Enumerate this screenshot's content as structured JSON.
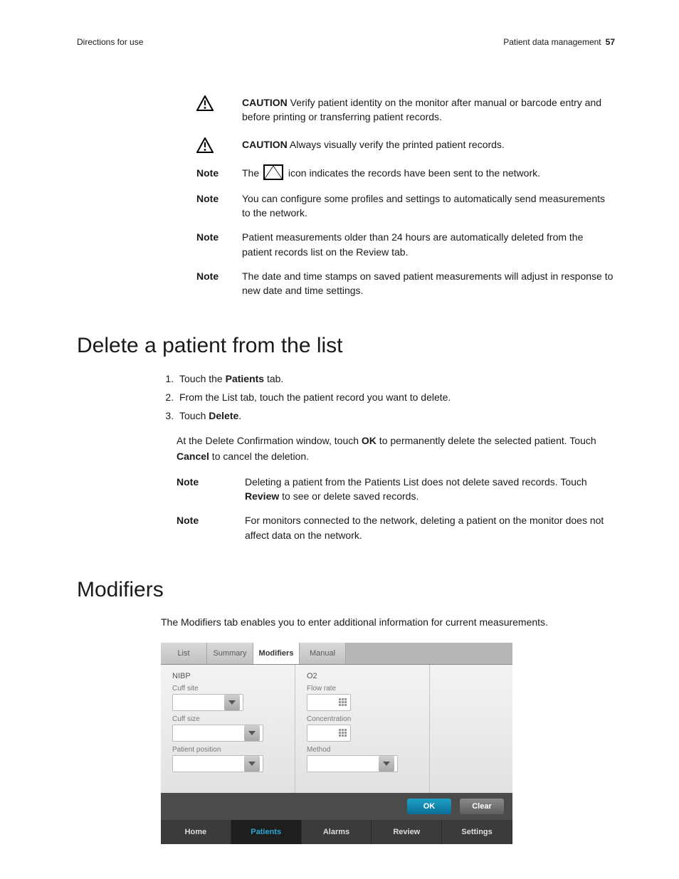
{
  "header": {
    "left": "Directions for use",
    "right_text": "Patient data management",
    "page_no": "57"
  },
  "cautions": [
    {
      "label": "CAUTION",
      "text": "Verify patient identity on the monitor after manual or barcode entry and before printing or transferring patient records."
    },
    {
      "label": "CAUTION",
      "text": "Always visually verify the printed patient records."
    }
  ],
  "top_notes": [
    {
      "label": "Note",
      "pre": "The ",
      "post": " icon indicates the records have been sent to the network.",
      "with_icon": true
    },
    {
      "label": "Note",
      "text": "You can configure some profiles and settings to automatically send measurements to the network."
    },
    {
      "label": "Note",
      "text": "Patient measurements older than 24 hours are automatically deleted from the patient records list on the Review tab."
    },
    {
      "label": "Note",
      "text": "The date and time stamps on saved patient measurements will adjust in response to new date and time settings."
    }
  ],
  "delete_section": {
    "title": "Delete a patient from the list",
    "steps": {
      "s1_pre": "Touch the ",
      "s1_bold": "Patients",
      "s1_post": " tab.",
      "s2": "From the List tab, touch the patient record you want to delete.",
      "s3_pre": "Touch ",
      "s3_bold": "Delete",
      "s3_post": "."
    },
    "after": {
      "p1": "At the Delete Confirmation window, touch ",
      "ok": "OK",
      "p2": " to permanently delete the selected patient. Touch ",
      "cancel": "Cancel",
      "p3": " to cancel the deletion."
    },
    "notes": [
      {
        "label": "Note",
        "pre": "Deleting a patient from the Patients List does not delete saved records. Touch ",
        "bold": "Review",
        "post": " to see or delete saved records."
      },
      {
        "label": "Note",
        "text": "For monitors connected to the network, deleting a patient on the monitor does not affect data on the network."
      }
    ]
  },
  "modifiers_section": {
    "title": "Modifiers",
    "intro": "The Modifiers tab enables you to enter additional information for current measurements."
  },
  "screenshot": {
    "tabs": [
      "List",
      "Summary",
      "Modifiers",
      "Manual"
    ],
    "active_tab": "Modifiers",
    "nibp": {
      "title": "NIBP",
      "cuff_site": "Cuff site",
      "cuff_size": "Cuff size",
      "patient_position": "Patient position"
    },
    "o2": {
      "title": "O2",
      "flow_rate": "Flow rate",
      "concentration": "Concentration",
      "method": "Method"
    },
    "buttons": {
      "ok": "OK",
      "clear": "Clear"
    },
    "nav": [
      "Home",
      "Patients",
      "Alarms",
      "Review",
      "Settings"
    ],
    "nav_active": "Patients"
  }
}
